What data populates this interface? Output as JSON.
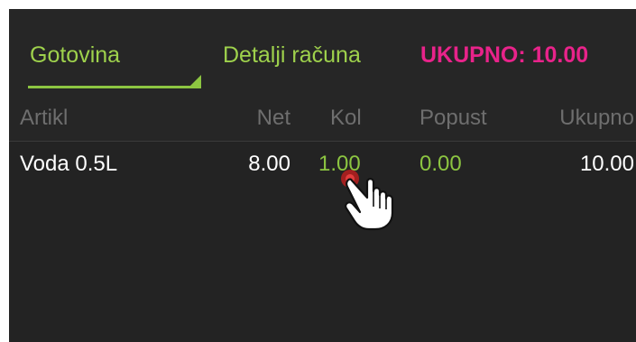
{
  "tabs": {
    "cash_label": "Gotovina",
    "details_label": "Detalji računa"
  },
  "total": {
    "label": "UKUPNO: 10.00"
  },
  "table": {
    "columns": [
      "Artikl",
      "Net",
      "Kol",
      "Popust",
      "Ukupno"
    ],
    "rows": [
      [
        "Voda 0.5L",
        "8.00",
        "1.00",
        "0.00",
        "10.00"
      ]
    ]
  },
  "colors": {
    "accent_green": "#8cc541",
    "total_pink": "#e8238a",
    "background": "#232323"
  },
  "icons": {
    "cursor": "hand-pointer-icon"
  }
}
